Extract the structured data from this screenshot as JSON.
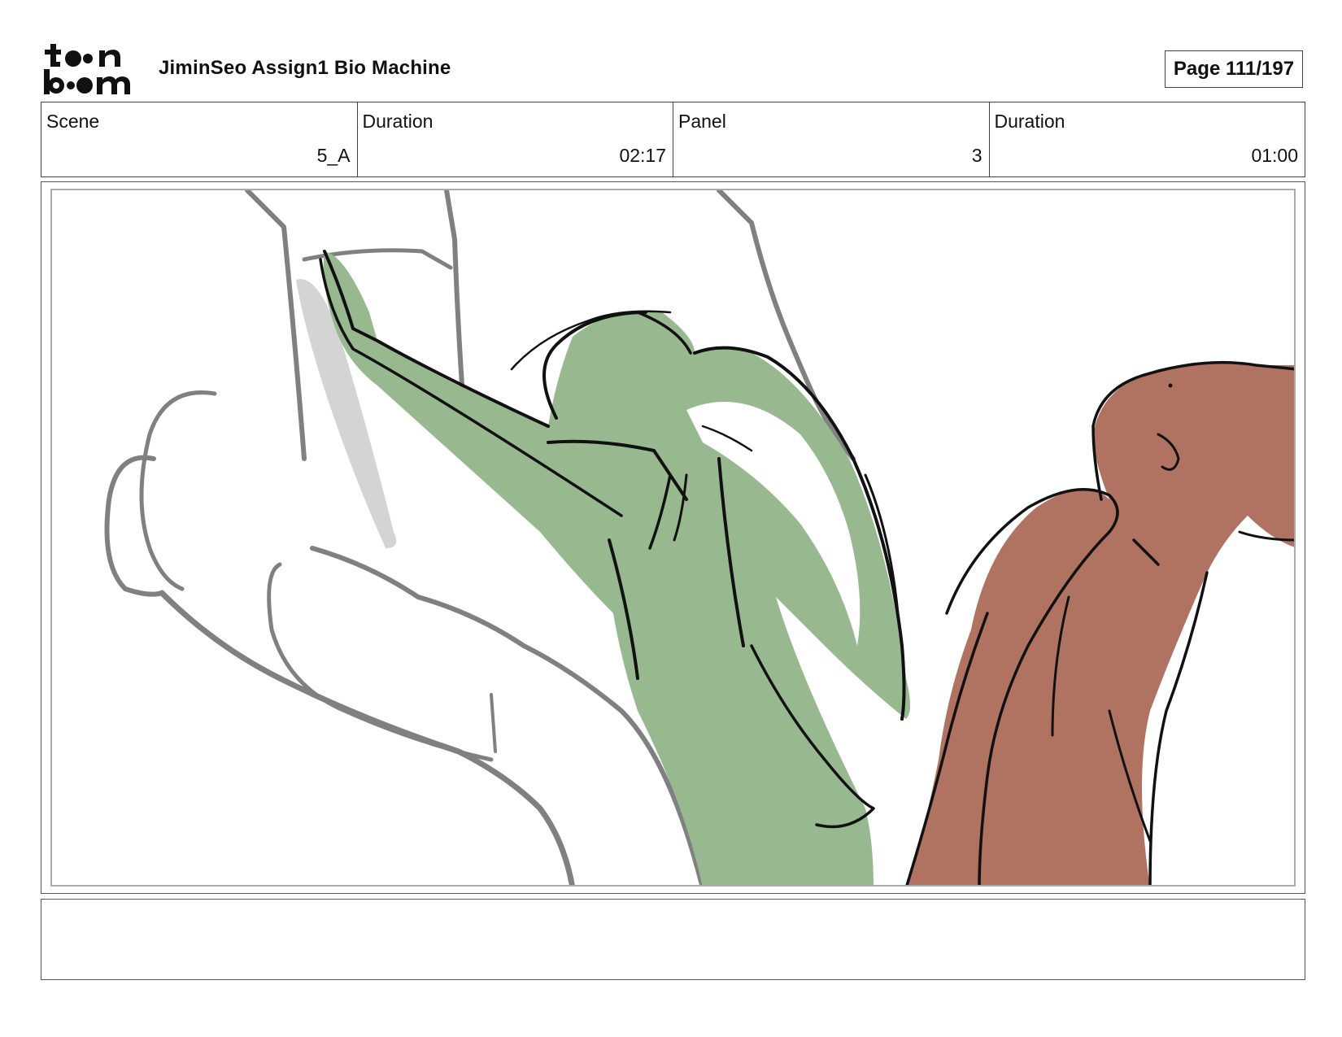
{
  "header": {
    "logo_text": "toonboom",
    "project_title": "JiminSeo Assign1 Bio Machine",
    "page_label": "Page 111/197"
  },
  "info": {
    "scene_label": "Scene",
    "scene_value": "5_A",
    "scene_duration_label": "Duration",
    "scene_duration_value": "02:17",
    "panel_label": "Panel",
    "panel_value": "3",
    "panel_duration_label": "Duration",
    "panel_duration_value": "01:00"
  },
  "colors": {
    "green_character": "#98b88f",
    "brown_character": "#b07362",
    "sketch_gray": "#777777",
    "ink": "#111111"
  },
  "notes": {
    "text": ""
  }
}
